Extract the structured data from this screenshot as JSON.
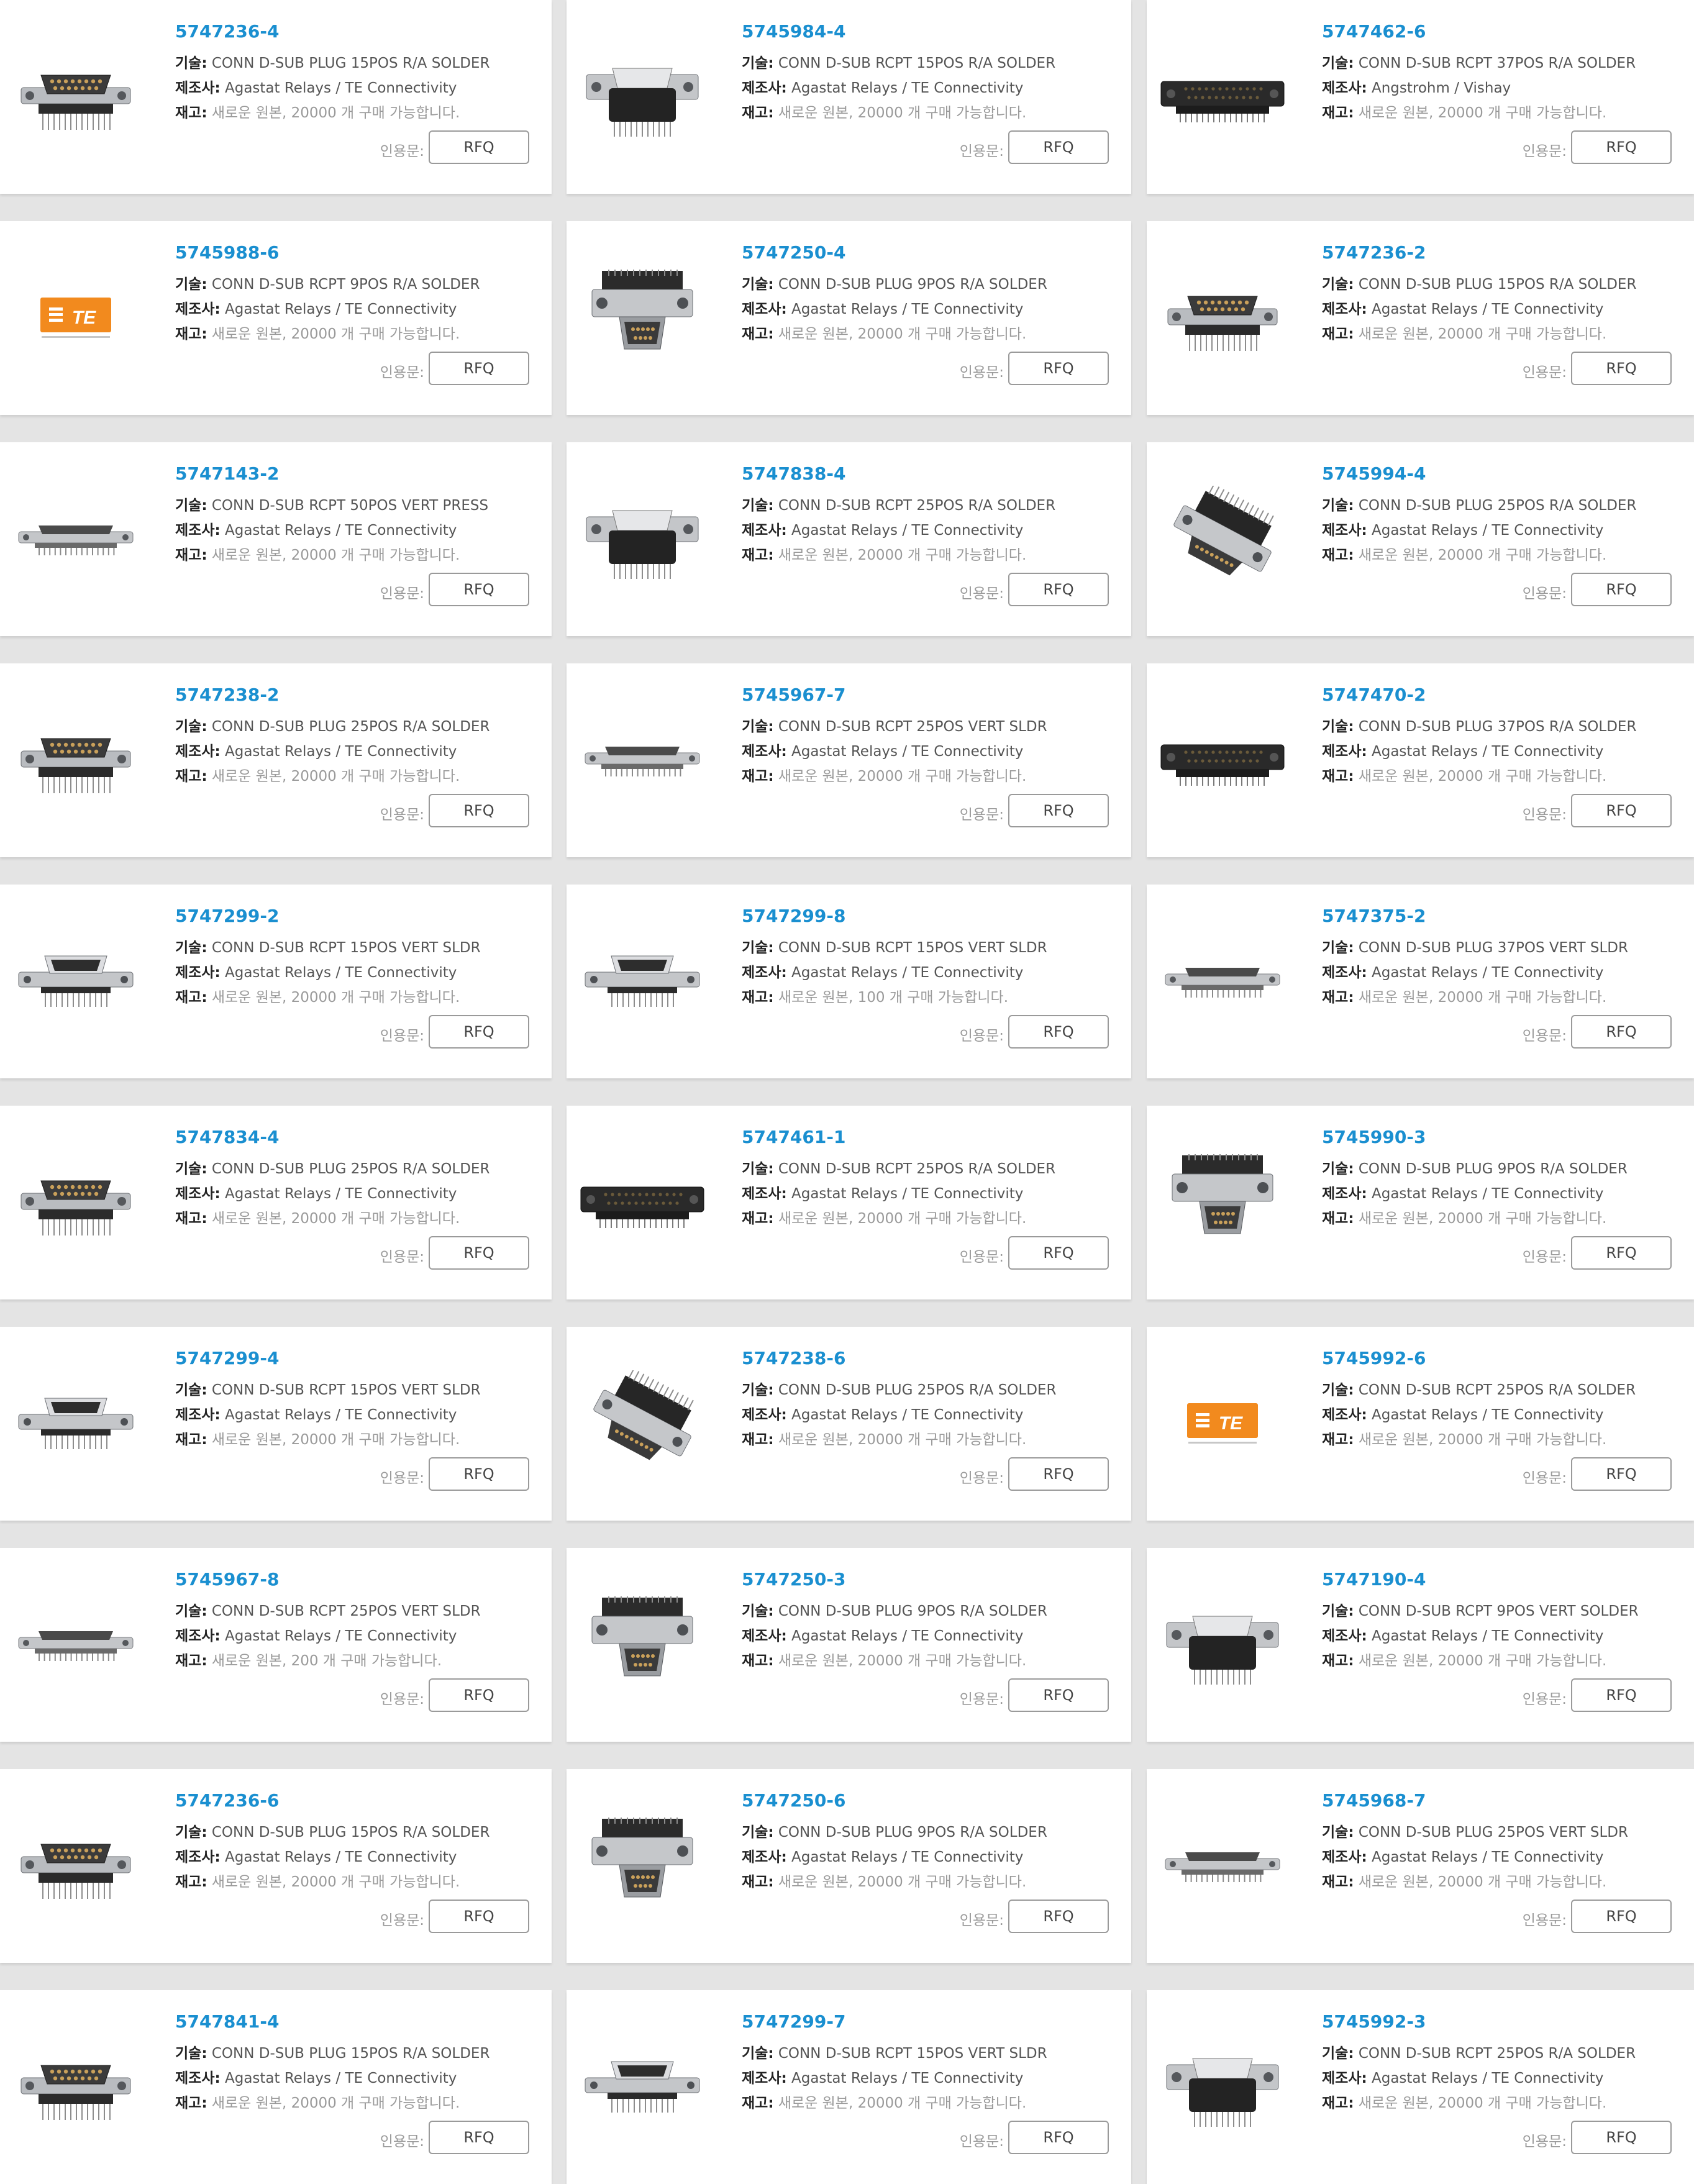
{
  "labels": {
    "desc": "기술:",
    "mfr": "제조사:",
    "stock": "재고:",
    "quote": "인용문:",
    "rfq": "RFQ"
  },
  "products": [
    {
      "pn": "5747236-4",
      "desc": "CONN D-SUB PLUG 15POS R/A SOLDER",
      "mfr": "Agastat Relays / TE Connectivity",
      "stock": "새로운 원본, 20000 개 구매 가능합니다.",
      "thumb": "plug-ra"
    },
    {
      "pn": "5745984-4",
      "desc": "CONN D-SUB RCPT 15POS R/A SOLDER",
      "mfr": "Agastat Relays / TE Connectivity",
      "stock": "새로운 원본, 20000 개 구매 가능합니다.",
      "thumb": "rcpt-ra"
    },
    {
      "pn": "5747462-6",
      "desc": "CONN D-SUB RCPT 37POS R/A SOLDER",
      "mfr": "Angstrohm / Vishay",
      "stock": "새로운 원본, 20000 개 구매 가능합니다.",
      "thumb": "dark-wide"
    },
    {
      "pn": "5745988-6",
      "desc": "CONN D-SUB RCPT 9POS R/A SOLDER",
      "mfr": "Agastat Relays / TE Connectivity",
      "stock": "새로운 원본, 20000 개 구매 가능합니다.",
      "thumb": "te-logo"
    },
    {
      "pn": "5747250-4",
      "desc": "CONN D-SUB PLUG 9POS R/A SOLDER",
      "mfr": "Agastat Relays / TE Connectivity",
      "stock": "새로운 원본, 20000 개 구매 가능합니다.",
      "thumb": "plug-9"
    },
    {
      "pn": "5747236-2",
      "desc": "CONN D-SUB PLUG 15POS R/A SOLDER",
      "mfr": "Agastat Relays / TE Connectivity",
      "stock": "새로운 원본, 20000 개 구매 가능합니다.",
      "thumb": "plug-ra"
    },
    {
      "pn": "5747143-2",
      "desc": "CONN D-SUB RCPT 50POS VERT PRESS",
      "mfr": "Agastat Relays / TE Connectivity",
      "stock": "새로운 원본, 20000 개 구매 가능합니다.",
      "thumb": "flat"
    },
    {
      "pn": "5747838-4",
      "desc": "CONN D-SUB RCPT 25POS R/A SOLDER",
      "mfr": "Agastat Relays / TE Connectivity",
      "stock": "새로운 원본, 20000 개 구매 가능합니다.",
      "thumb": "rcpt-ra"
    },
    {
      "pn": "5745994-4",
      "desc": "CONN D-SUB PLUG 25POS R/A SOLDER",
      "mfr": "Agastat Relays / TE Connectivity",
      "stock": "새로운 원본, 20000 개 구매 가능합니다.",
      "thumb": "angled"
    },
    {
      "pn": "5747238-2",
      "desc": "CONN D-SUB PLUG 25POS R/A SOLDER",
      "mfr": "Agastat Relays / TE Connectivity",
      "stock": "새로운 원본, 20000 개 구매 가능합니다.",
      "thumb": "plug-ra"
    },
    {
      "pn": "5745967-7",
      "desc": "CONN D-SUB RCPT 25POS VERT SLDR",
      "mfr": "Agastat Relays / TE Connectivity",
      "stock": "새로운 원본, 20000 개 구매 가능합니다.",
      "thumb": "flat"
    },
    {
      "pn": "5747470-2",
      "desc": "CONN D-SUB PLUG 37POS R/A SOLDER",
      "mfr": "Agastat Relays / TE Connectivity",
      "stock": "새로운 원본, 20000 개 구매 가능합니다.",
      "thumb": "dark-wide"
    },
    {
      "pn": "5747299-2",
      "desc": "CONN D-SUB RCPT 15POS VERT SLDR",
      "mfr": "Agastat Relays / TE Connectivity",
      "stock": "새로운 원본, 20000 개 구매 가능합니다.",
      "thumb": "vert"
    },
    {
      "pn": "5747299-8",
      "desc": "CONN D-SUB RCPT 15POS VERT SLDR",
      "mfr": "Agastat Relays / TE Connectivity",
      "stock": "새로운 원본, 100 개 구매 가능합니다.",
      "thumb": "vert"
    },
    {
      "pn": "5747375-2",
      "desc": "CONN D-SUB PLUG 37POS VERT SLDR",
      "mfr": "Agastat Relays / TE Connectivity",
      "stock": "새로운 원본, 20000 개 구매 가능합니다.",
      "thumb": "flat"
    },
    {
      "pn": "5747834-4",
      "desc": "CONN D-SUB PLUG 25POS R/A SOLDER",
      "mfr": "Agastat Relays / TE Connectivity",
      "stock": "새로운 원본, 20000 개 구매 가능합니다.",
      "thumb": "plug-ra"
    },
    {
      "pn": "5747461-1",
      "desc": "CONN D-SUB RCPT 25POS R/A SOLDER",
      "mfr": "Agastat Relays / TE Connectivity",
      "stock": "새로운 원본, 20000 개 구매 가능합니다.",
      "thumb": "dark-wide"
    },
    {
      "pn": "5745990-3",
      "desc": "CONN D-SUB PLUG 9POS R/A SOLDER",
      "mfr": "Agastat Relays / TE Connectivity",
      "stock": "새로운 원본, 20000 개 구매 가능합니다.",
      "thumb": "plug-9"
    },
    {
      "pn": "5747299-4",
      "desc": "CONN D-SUB RCPT 15POS VERT SLDR",
      "mfr": "Agastat Relays / TE Connectivity",
      "stock": "새로운 원본, 20000 개 구매 가능합니다.",
      "thumb": "vert"
    },
    {
      "pn": "5747238-6",
      "desc": "CONN D-SUB PLUG 25POS R/A SOLDER",
      "mfr": "Agastat Relays / TE Connectivity",
      "stock": "새로운 원본, 20000 개 구매 가능합니다.",
      "thumb": "angled"
    },
    {
      "pn": "5745992-6",
      "desc": "CONN D-SUB RCPT 25POS R/A SOLDER",
      "mfr": "Agastat Relays / TE Connectivity",
      "stock": "새로운 원본, 20000 개 구매 가능합니다.",
      "thumb": "te-logo"
    },
    {
      "pn": "5745967-8",
      "desc": "CONN D-SUB RCPT 25POS VERT SLDR",
      "mfr": "Agastat Relays / TE Connectivity",
      "stock": "새로운 원본, 200 개 구매 가능합니다.",
      "thumb": "flat"
    },
    {
      "pn": "5747250-3",
      "desc": "CONN D-SUB PLUG 9POS R/A SOLDER",
      "mfr": "Agastat Relays / TE Connectivity",
      "stock": "새로운 원본, 20000 개 구매 가능합니다.",
      "thumb": "plug-9"
    },
    {
      "pn": "5747190-4",
      "desc": "CONN D-SUB RCPT 9POS VERT SOLDER",
      "mfr": "Agastat Relays / TE Connectivity",
      "stock": "새로운 원본, 20000 개 구매 가능합니다.",
      "thumb": "rcpt-ra"
    },
    {
      "pn": "5747236-6",
      "desc": "CONN D-SUB PLUG 15POS R/A SOLDER",
      "mfr": "Agastat Relays / TE Connectivity",
      "stock": "새로운 원본, 20000 개 구매 가능합니다.",
      "thumb": "plug-ra"
    },
    {
      "pn": "5747250-6",
      "desc": "CONN D-SUB PLUG 9POS R/A SOLDER",
      "mfr": "Agastat Relays / TE Connectivity",
      "stock": "새로운 원본, 20000 개 구매 가능합니다.",
      "thumb": "plug-9"
    },
    {
      "pn": "5745968-7",
      "desc": "CONN D-SUB PLUG 25POS VERT SLDR",
      "mfr": "Agastat Relays / TE Connectivity",
      "stock": "새로운 원본, 20000 개 구매 가능합니다.",
      "thumb": "flat"
    },
    {
      "pn": "5747841-4",
      "desc": "CONN D-SUB PLUG 15POS R/A SOLDER",
      "mfr": "Agastat Relays / TE Connectivity",
      "stock": "새로운 원본, 20000 개 구매 가능합니다.",
      "thumb": "plug-ra"
    },
    {
      "pn": "5747299-7",
      "desc": "CONN D-SUB RCPT 15POS VERT SLDR",
      "mfr": "Agastat Relays / TE Connectivity",
      "stock": "새로운 원본, 20000 개 구매 가능합니다.",
      "thumb": "vert"
    },
    {
      "pn": "5745992-3",
      "desc": "CONN D-SUB RCPT 25POS R/A SOLDER",
      "mfr": "Agastat Relays / TE Connectivity",
      "stock": "새로운 원본, 20000 개 구매 가능합니다.",
      "thumb": "rcpt-ra"
    }
  ]
}
